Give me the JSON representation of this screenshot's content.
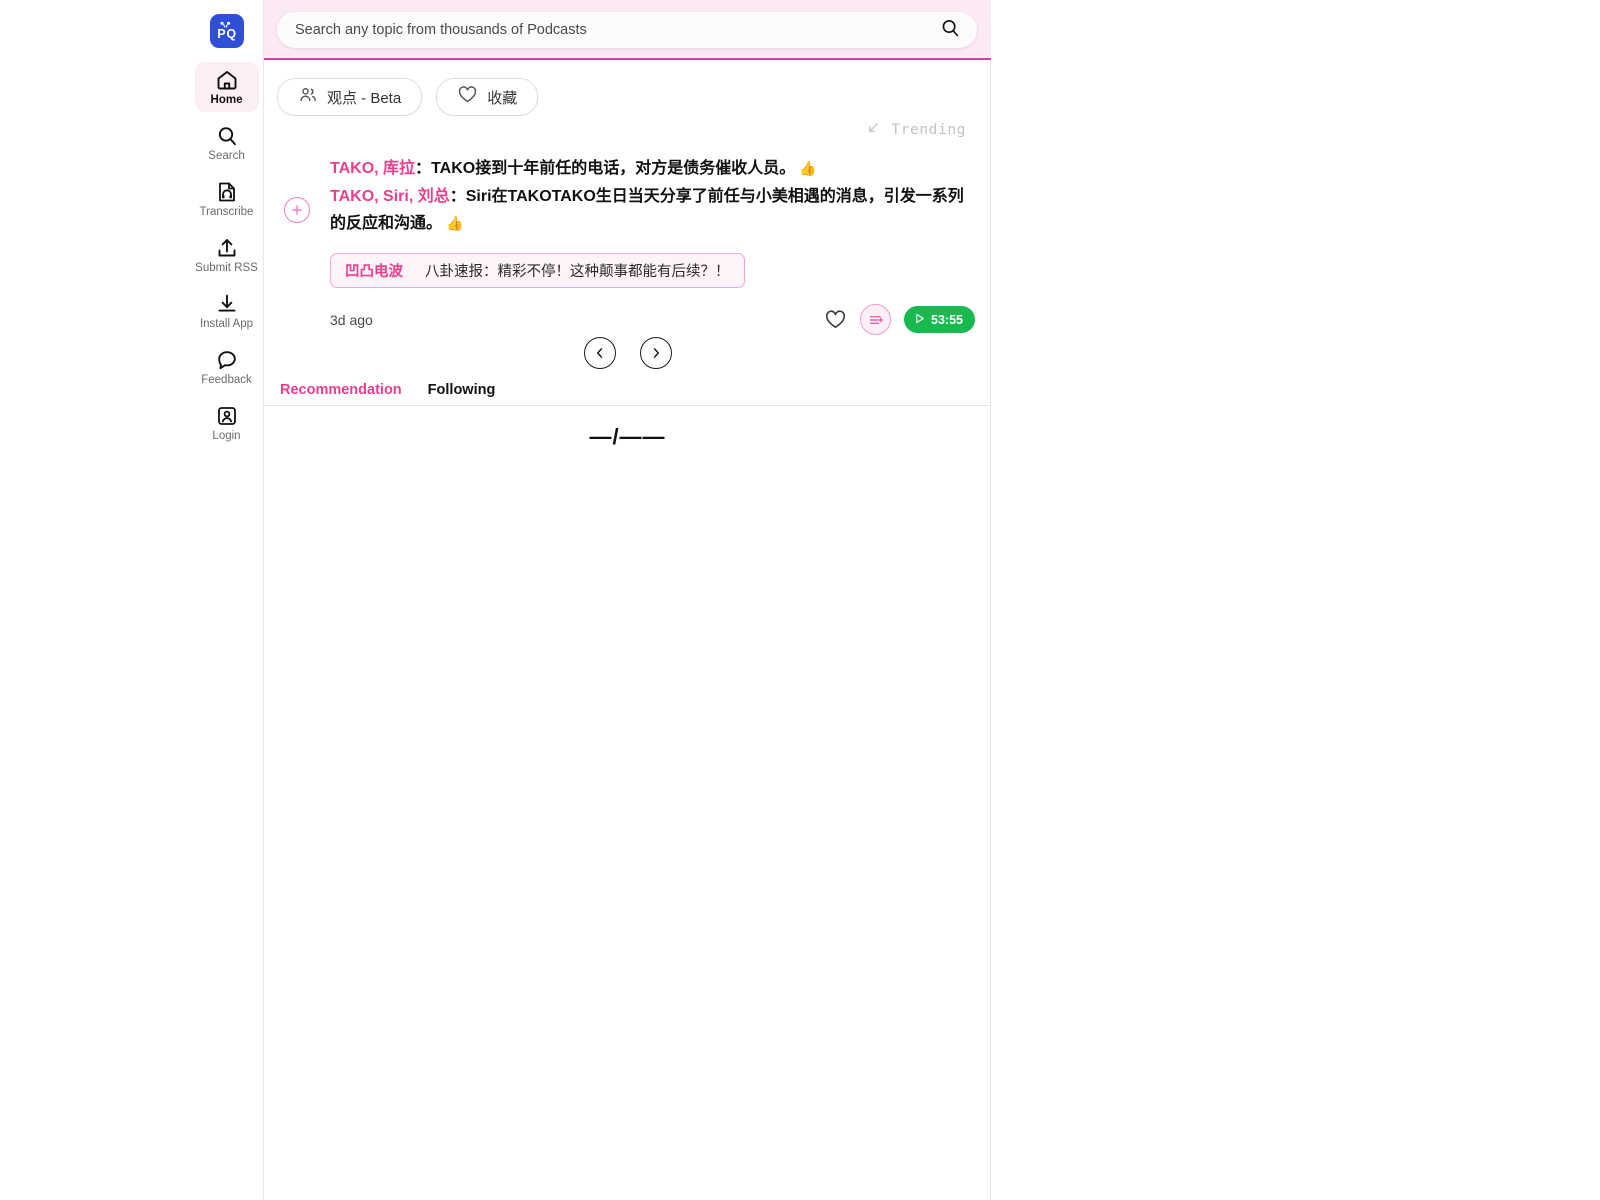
{
  "app": {
    "logo_text_left": "P",
    "logo_text_right": "Q",
    "logo_color": "#2f4fd8"
  },
  "sidebar": {
    "items": [
      {
        "label": "Home",
        "icon": "home-icon",
        "active": true
      },
      {
        "label": "Search",
        "icon": "search-icon",
        "active": false
      },
      {
        "label": "Transcribe",
        "icon": "transcribe-icon",
        "active": false
      },
      {
        "label": "Submit RSS",
        "icon": "upload-icon",
        "active": false
      },
      {
        "label": "Install App",
        "icon": "download-icon",
        "active": false
      },
      {
        "label": "Feedback",
        "icon": "chat-bubble-icon",
        "active": false
      },
      {
        "label": "Login",
        "icon": "user-badge-icon",
        "active": false
      }
    ]
  },
  "search": {
    "placeholder": "Search any topic from thousands of Podcasts",
    "value": "",
    "icon": "search-icon"
  },
  "filters": [
    {
      "label": "观点 - Beta",
      "icon": "people-icon"
    },
    {
      "label": "收藏",
      "icon": "heart-icon"
    }
  ],
  "trending": {
    "label": "Trending",
    "icon": "arrow-down-left-icon"
  },
  "card": {
    "summaries": [
      {
        "speakers": "TAKO, 库拉",
        "separator": "：",
        "text": "TAKO接到十年前任的电话，对方是债务催收人员。",
        "reaction": "👍"
      },
      {
        "speakers": "TAKO, Siri, 刘总",
        "separator": "：",
        "text": "Siri在TAKOTAKO生日当天分享了前任与小美相遇的消息，引发一系列的反应和沟通。",
        "reaction": "👍"
      }
    ],
    "show_name": "凹凸电波",
    "episode_title": "八卦速报：精彩不停！这种颠事都能有后续？！",
    "time_ago": "3d ago",
    "favorite_icon": "heart-icon",
    "transcript_icon": "transcript-add-icon",
    "play": {
      "duration": "53:55",
      "icon": "play-icon",
      "color": "#18b94e"
    },
    "add_icon": "plus-circle-icon"
  },
  "carousel": {
    "prev_icon": "chevron-left-circle-icon",
    "next_icon": "chevron-right-circle-icon"
  },
  "tabs": [
    {
      "label": "Recommendation",
      "active": true
    },
    {
      "label": "Following",
      "active": false
    }
  ],
  "placeholder": {
    "text": "—/——"
  },
  "colors": {
    "accent_pink": "#ec3d8e",
    "header_bg": "#fbeaf3",
    "header_border": "#cc3fae",
    "green": "#18b94e"
  }
}
